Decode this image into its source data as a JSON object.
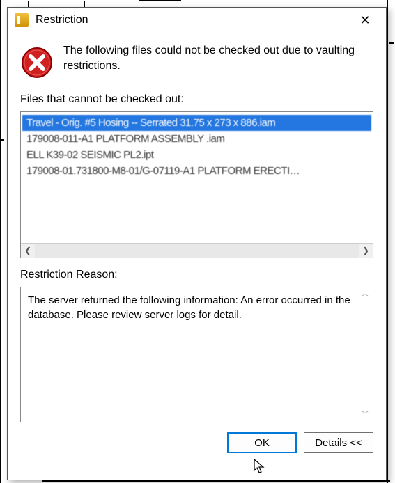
{
  "window": {
    "title": "Restriction"
  },
  "message": "The following files could not be checked out due to vaulting restrictions.",
  "labels": {
    "files_label": "Files that cannot be checked out:",
    "reason_label": "Restriction Reason:"
  },
  "files": [
    "Travel - Orig. #5 Hosing -- Serrated 31.75 x 273 x 886.iam",
    "179008-011-A1 PLATFORM ASSEMBLY .iam",
    "ELL K39-02 SEISMIC PL2.ipt",
    "179008-01.731800-M8-01/G-07119-A1 PLATFORM ERECTI…"
  ],
  "reason_text": "The server returned the following information:  An error occurred in the database. Please review server logs for detail.",
  "buttons": {
    "ok": "OK",
    "details": "Details <<"
  },
  "icons": {
    "close": "✕",
    "scroll_left": "❮",
    "scroll_right": "❯",
    "scroll_up": "︿",
    "scroll_down": "﹀"
  }
}
